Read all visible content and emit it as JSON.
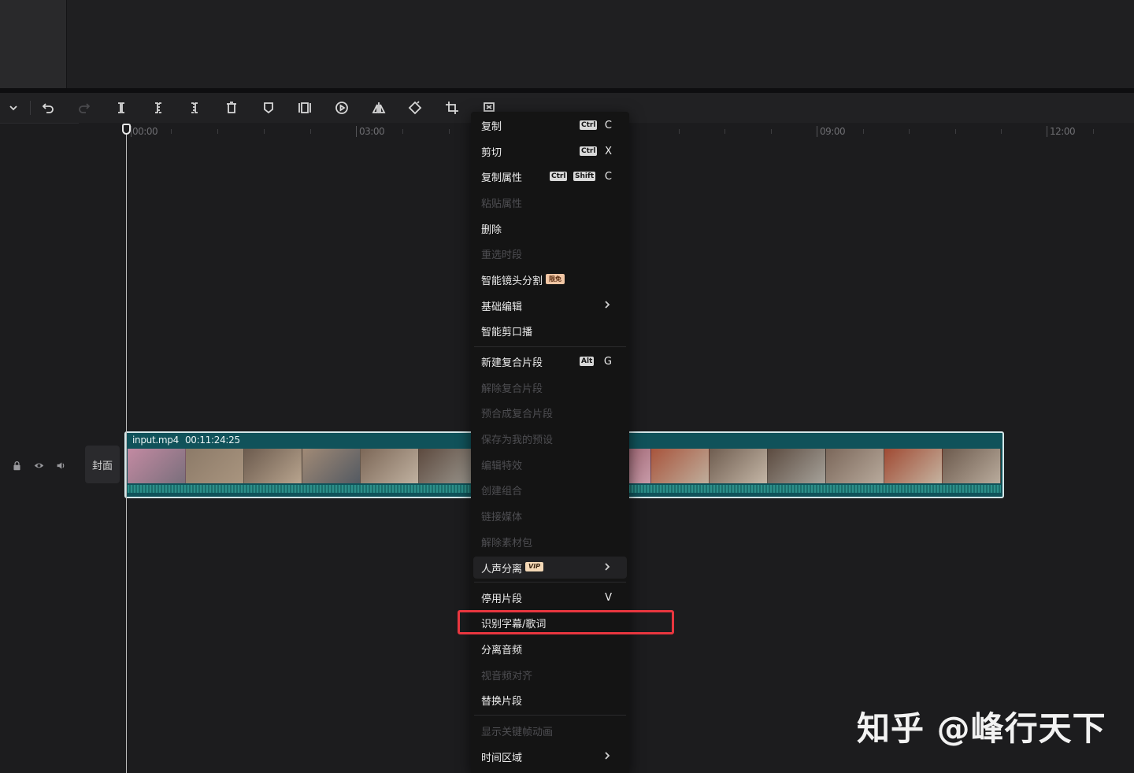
{
  "timeline": {
    "ruler_labels": [
      "00:00",
      "03:00",
      "09:00",
      "12:00"
    ]
  },
  "track": {
    "cover_label": "封面"
  },
  "clip": {
    "filename": "input.mp4",
    "duration": "00:11:24:25"
  },
  "context_menu": {
    "items": [
      {
        "label": "复制",
        "keys": [
          "Ctrl"
        ],
        "letter": "C",
        "enabled": true
      },
      {
        "label": "剪切",
        "keys": [
          "Ctrl"
        ],
        "letter": "X",
        "enabled": true
      },
      {
        "label": "复制属性",
        "keys": [
          "Ctrl",
          "Shift"
        ],
        "letter": "C",
        "enabled": true
      },
      {
        "label": "粘贴属性",
        "enabled": false
      },
      {
        "label": "删除",
        "enabled": true
      },
      {
        "label": "重选时段",
        "enabled": false
      },
      {
        "label": "智能镜头分割",
        "badge": "限免",
        "enabled": true
      },
      {
        "label": "基础编辑",
        "submenu": true,
        "enabled": true
      },
      {
        "label": "智能剪口播",
        "enabled": true
      },
      {
        "label": "新建复合片段",
        "keys": [
          "Alt"
        ],
        "letter": "G",
        "enabled": true
      },
      {
        "label": "解除复合片段",
        "enabled": false
      },
      {
        "label": "预合成复合片段",
        "enabled": false
      },
      {
        "label": "保存为我的预设",
        "enabled": false
      },
      {
        "label": "编辑特效",
        "enabled": false
      },
      {
        "label": "创建组合",
        "enabled": false
      },
      {
        "label": "链接媒体",
        "enabled": false
      },
      {
        "label": "解除素材包",
        "enabled": false
      },
      {
        "label": "人声分离",
        "badge": "VIP",
        "submenu": true,
        "enabled": true
      },
      {
        "label": "停用片段",
        "letter": "V",
        "enabled": true
      },
      {
        "label": "识别字幕/歌词",
        "enabled": true,
        "highlighted": true
      },
      {
        "label": "分离音频",
        "enabled": true
      },
      {
        "label": "视音频对齐",
        "enabled": false
      },
      {
        "label": "替换片段",
        "enabled": true
      },
      {
        "label": "显示关键帧动画",
        "enabled": false
      },
      {
        "label": "时间区域",
        "submenu": true,
        "enabled": true
      }
    ]
  },
  "watermark": "知乎 @峰行天下",
  "colors": {
    "clip_bg": "#10525a",
    "highlight_border": "#e8363f",
    "menu_bg": "#141414"
  }
}
